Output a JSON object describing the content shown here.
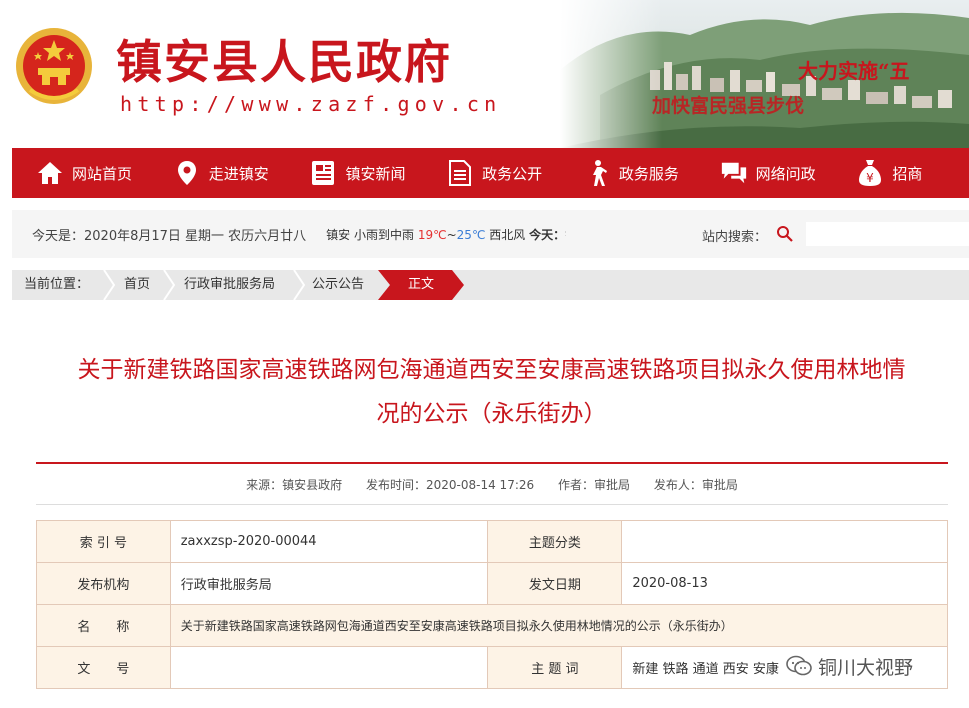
{
  "site": {
    "name": "镇安县人民政府",
    "url": "http://www.zazf.gov.cn",
    "banner_slogan_1": "大力实施“五",
    "banner_slogan_2": "加快富民强县步伐"
  },
  "nav": [
    {
      "label": "网站首页",
      "icon": "home-icon"
    },
    {
      "label": "走进镇安",
      "icon": "location-pin-icon"
    },
    {
      "label": "镇安新闻",
      "icon": "newspaper-icon"
    },
    {
      "label": "政务公开",
      "icon": "document-icon"
    },
    {
      "label": "政务服务",
      "icon": "person-walking-icon"
    },
    {
      "label": "网络问政",
      "icon": "chat-bubbles-icon"
    },
    {
      "label": "招商",
      "icon": "money-bag-icon"
    }
  ],
  "infobar": {
    "date": "今天是：2020年8月17日   星期一   农历六月廿八",
    "weather_city": "镇安",
    "weather_desc": "小雨到中雨",
    "weather_high": "19℃",
    "weather_sep": "~",
    "weather_low": "25℃",
    "weather_wind": "西北风",
    "weather_today": "今天：",
    "weather_tail": "镇",
    "search_label": "站内搜索：",
    "search_placeholder": ""
  },
  "breadcrumb": {
    "label": "当前位置：",
    "items": [
      "首页",
      "行政审批服务局",
      "公示公告"
    ],
    "active": "正文"
  },
  "article": {
    "title_line1": "关于新建铁路国家高速铁路网包海通道西安至安康高速铁路项目拟永久使用林地情",
    "title_line2": "况的公示（永乐街办）",
    "meta": {
      "source": "来源：镇安县政府",
      "time": "发布时间：2020-08-14 17:26",
      "author": "作者：审批局",
      "publisher": "发布人：审批局"
    }
  },
  "info_table": {
    "index_label": "索 引 号",
    "index_value": "zaxxzsp-2020-00044",
    "topic_label": "主题分类",
    "topic_value": "",
    "org_label": "发布机构",
    "org_value": "行政审批服务局",
    "date_label": "发文日期",
    "date_value": "2020-08-13",
    "name_label": "名　　称",
    "name_value": "关于新建铁路国家高速铁路网包海通道西安至安康高速铁路项目拟永久使用林地情况的公示（永乐街办）",
    "docno_label": "文　　号",
    "docno_value": "",
    "keyword_label": "主 题 词",
    "keyword_value": "新建 铁路 通道 西安 安康"
  },
  "watermark": {
    "text": "铜川大视野"
  },
  "colors": {
    "brand_red": "#c8161d",
    "table_tint": "#fdf3e6",
    "breadcrumb_bg": "#e8e8e8"
  }
}
